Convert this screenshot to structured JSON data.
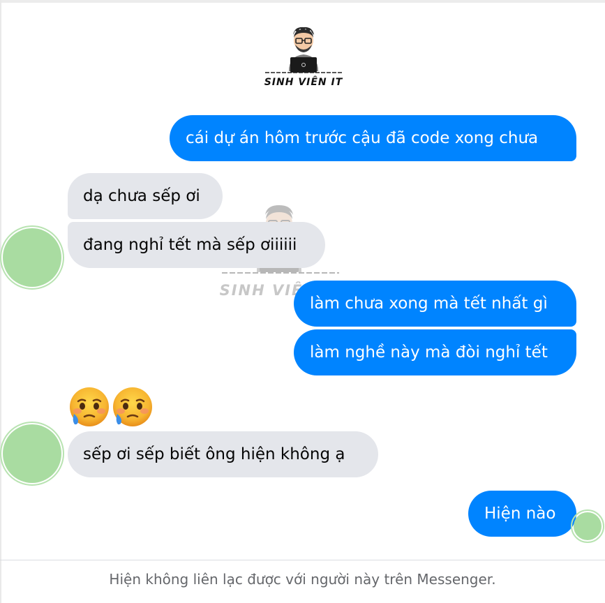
{
  "logo": {
    "brand_text": "SINH VIÊN IT",
    "watermark_text": "SINH VIÊN IT"
  },
  "messages": [
    {
      "from": "me",
      "text": "cái dự án hôm trước cậu đã code xong chưa"
    },
    {
      "from": "them",
      "text": "dạ chưa sếp ơi"
    },
    {
      "from": "them",
      "text": "đang nghỉ tết mà sếp ơiiiiii"
    },
    {
      "from": "me",
      "text": "làm chưa xong mà tết nhất gì"
    },
    {
      "from": "me",
      "text": "làm nghề này mà đòi nghỉ tết"
    },
    {
      "from": "them",
      "emoji": "crying-face-icon x2"
    },
    {
      "from": "them",
      "text": "sếp ơi sếp biết ông hiện không ạ"
    },
    {
      "from": "me",
      "text": "Hiện nào"
    }
  ],
  "footer": {
    "notice": "Hiện không liên lạc được với người này trên Messenger."
  },
  "colors": {
    "sent_bubble": "#0084ff",
    "received_bubble": "#e4e6eb",
    "avatar": "#a9dca1",
    "footer_text": "#65676b"
  }
}
